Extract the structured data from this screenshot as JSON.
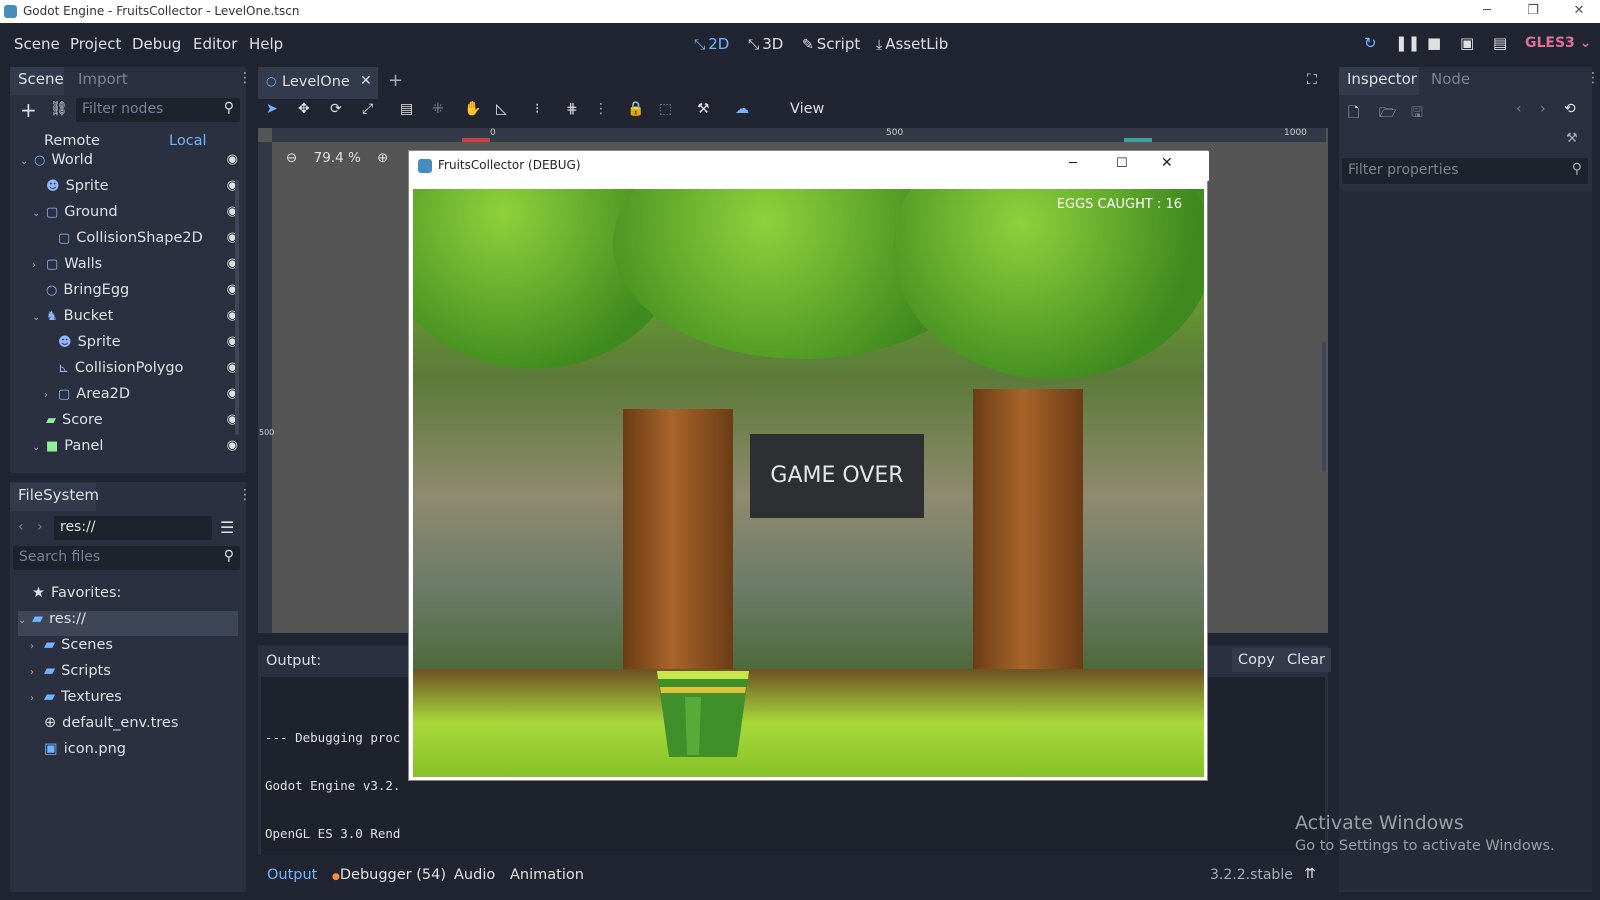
{
  "window": {
    "title": "Godot Engine - FruitsCollector - LevelOne.tscn",
    "min": "─",
    "max": "❐",
    "close": "✕"
  },
  "menu": [
    "Scene",
    "Project",
    "Debug",
    "Editor",
    "Help"
  ],
  "modes": [
    {
      "label": "2D",
      "icon": "⤡"
    },
    {
      "label": "3D",
      "icon": "⤡"
    },
    {
      "label": "Script",
      "icon": "✎"
    },
    {
      "label": "AssetLib",
      "icon": "⤓"
    }
  ],
  "renderer": "GLES3",
  "scene_dock": {
    "tabs": [
      "Scene",
      "Import"
    ],
    "filter_placeholder": "Filter nodes",
    "remote": "Remote",
    "local": "Local",
    "nodes": [
      {
        "label": "World",
        "indent": 0,
        "arrow": "⌄",
        "color": "#6fb6ff",
        "shape": "circle"
      },
      {
        "label": "Sprite",
        "indent": 1,
        "arrow": "",
        "color": "#8fb6ff",
        "shape": "sprite"
      },
      {
        "label": "Ground",
        "indent": 1,
        "arrow": "⌄",
        "color": "#8fb6ff",
        "shape": "square"
      },
      {
        "label": "CollisionShape2D",
        "indent": 2,
        "arrow": "",
        "color": "#8fb6ff",
        "shape": "square"
      },
      {
        "label": "Walls",
        "indent": 1,
        "arrow": "›",
        "color": "#8fb6ff",
        "shape": "square"
      },
      {
        "label": "BringEgg",
        "indent": 1,
        "arrow": "",
        "color": "#8fb6ff",
        "shape": "circle"
      },
      {
        "label": "Bucket",
        "indent": 1,
        "arrow": "⌄",
        "color": "#8fb6ff",
        "shape": "person"
      },
      {
        "label": "Sprite",
        "indent": 2,
        "arrow": "",
        "color": "#8fb6ff",
        "shape": "sprite"
      },
      {
        "label": "CollisionPolygo",
        "indent": 2,
        "arrow": "",
        "color": "#8fb6ff",
        "shape": "poly"
      },
      {
        "label": "Area2D",
        "indent": 2,
        "arrow": "›",
        "color": "#8fb6ff",
        "shape": "square"
      },
      {
        "label": "Score",
        "indent": 1,
        "arrow": "",
        "color": "#8eef97",
        "shape": "label"
      },
      {
        "label": "Panel",
        "indent": 1,
        "arrow": "⌄",
        "color": "#8eef97",
        "shape": "fill"
      }
    ]
  },
  "filesystem": {
    "tab": "FileSystem",
    "path": "res://",
    "search_placeholder": "Search files",
    "items": [
      {
        "label": "Favorites:",
        "indent": 0,
        "arrow": "",
        "icon": "★"
      },
      {
        "label": "res://",
        "indent": 0,
        "arrow": "⌄",
        "icon": "folder",
        "selected": true
      },
      {
        "label": "Scenes",
        "indent": 1,
        "arrow": "›",
        "icon": "folder"
      },
      {
        "label": "Scripts",
        "indent": 1,
        "arrow": "›",
        "icon": "folder"
      },
      {
        "label": "Textures",
        "indent": 1,
        "arrow": "›",
        "icon": "folder"
      },
      {
        "label": "default_env.tres",
        "indent": 1,
        "arrow": "",
        "icon": "globe"
      },
      {
        "label": "icon.png",
        "indent": 1,
        "arrow": "",
        "icon": "image"
      }
    ]
  },
  "editor": {
    "scene_tab": "LevelOne",
    "zoom": "79.4 %",
    "view_menu": "View",
    "ruler_marks": [
      "0",
      "500",
      "1000"
    ],
    "ruler_v_mark": "500"
  },
  "game": {
    "title": "FruitsCollector (DEBUG)",
    "eggs_caught": "EGGS CAUGHT : 16",
    "game_over": "GAME OVER"
  },
  "output": {
    "label": "Output:",
    "copy": "Copy",
    "clear": "Clear",
    "lines": [
      "--- Debugging proc",
      "Godot Engine v3.2.",
      "OpenGL ES 3.0 Rend"
    ],
    "tabs": [
      "Output",
      "Debugger (54)",
      "Audio",
      "Animation"
    ],
    "version": "3.2.2.stable"
  },
  "inspector": {
    "tabs": [
      "Inspector",
      "Node"
    ],
    "filter_placeholder": "Filter properties"
  },
  "watermark": {
    "line1": "Activate Windows",
    "line2": "Go to Settings to activate Windows."
  }
}
